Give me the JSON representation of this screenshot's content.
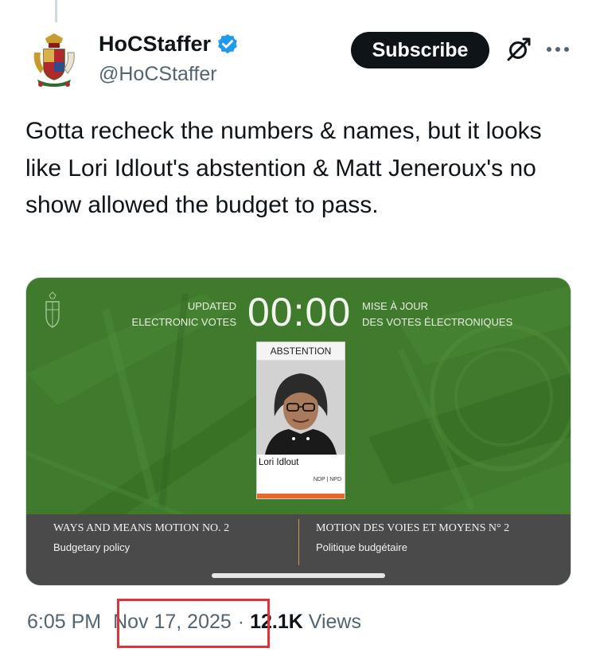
{
  "author": {
    "display_name": "HoCStaffer",
    "handle": "@HoCStaffer",
    "avatar_icon": "coat-of-arms-icon",
    "verified_icon": "verified-badge-icon",
    "verified_color": "#1d9bf0"
  },
  "actions": {
    "subscribe_label": "Subscribe",
    "grok_icon": "grok-icon",
    "more_icon": "more-options-icon"
  },
  "tweet": {
    "text": "Gotta recheck the numbers & names, but it looks like Lori Idlout's abstention & Matt Jeneroux's no show allowed the budget to pass."
  },
  "media": {
    "updated_en_line1": "UPDATED",
    "updated_en_line2": "ELECTRONIC VOTES",
    "timer": "00:00",
    "updated_fr_line1": "MISE À JOUR",
    "updated_fr_line2": "DES VOTES ÉLECTRONIQUES",
    "card": {
      "status": "ABSTENTION",
      "mp_name": "Lori Idlout",
      "party": "NDP | NPD",
      "party_color": "#e8682a"
    },
    "motion": {
      "en_title": "WAYS AND MEANS MOTION NO. 2",
      "en_subtitle": "Budgetary policy",
      "fr_title": "MOTION DES VOIES ET MOYENS N° 2",
      "fr_subtitle": "Politique budgétaire"
    },
    "background_color": "#3f7a2d"
  },
  "meta": {
    "time": "6:05 PM",
    "separator": "·",
    "date": "Nov 17, 2025",
    "separator2": "·",
    "views_count": "12.1K",
    "views_label": "Views",
    "highlight_color": "#e0323e"
  }
}
